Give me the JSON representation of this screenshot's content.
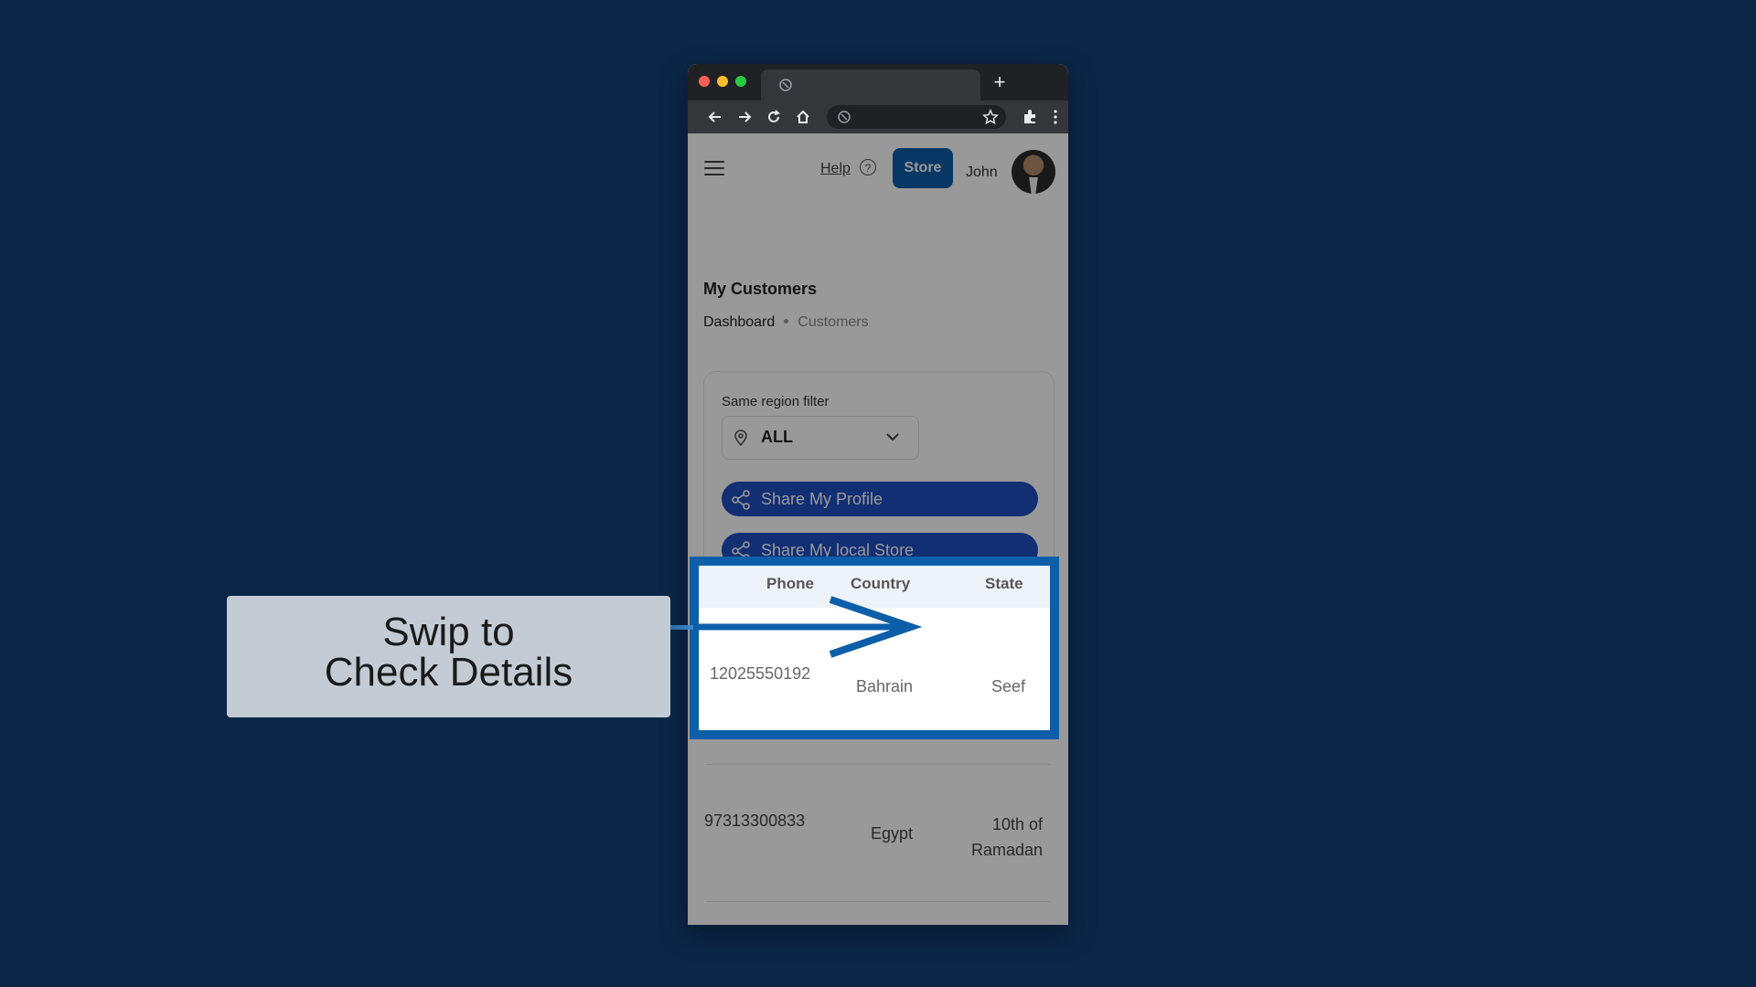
{
  "colors": {
    "background": "#0b2647",
    "accent": "#0d5ea8",
    "share_button": "#1e4fc0",
    "callout": "#c3cbd4"
  },
  "browser": {
    "window_controls": [
      "close-dot",
      "minimize-dot",
      "maximize-dot"
    ],
    "new_tab_label": "+",
    "toolbar_icons": [
      "back-icon",
      "forward-icon",
      "reload-icon",
      "home-icon",
      "star-icon",
      "extensions-icon",
      "menu-dots-icon"
    ]
  },
  "header": {
    "help_label": "Help",
    "help_icon": "?",
    "store_label": "Store",
    "user_name": "John"
  },
  "page": {
    "title": "My Customers",
    "breadcrumb": [
      "Dashboard",
      "Customers"
    ]
  },
  "filter": {
    "label": "Same region filter",
    "selected": "ALL",
    "share_profile": "Share My Profile",
    "share_store": "Share My local Store"
  },
  "table": {
    "columns": [
      "Phone",
      "Country",
      "State"
    ],
    "rows": [
      {
        "phone": "12025550192",
        "country": "Bahrain",
        "state": "Seef"
      },
      {
        "phone": "97313300833",
        "country": "Egypt",
        "state": "10th of\nRamadan"
      }
    ]
  },
  "callout": {
    "text": "Swip to\nCheck Details"
  }
}
